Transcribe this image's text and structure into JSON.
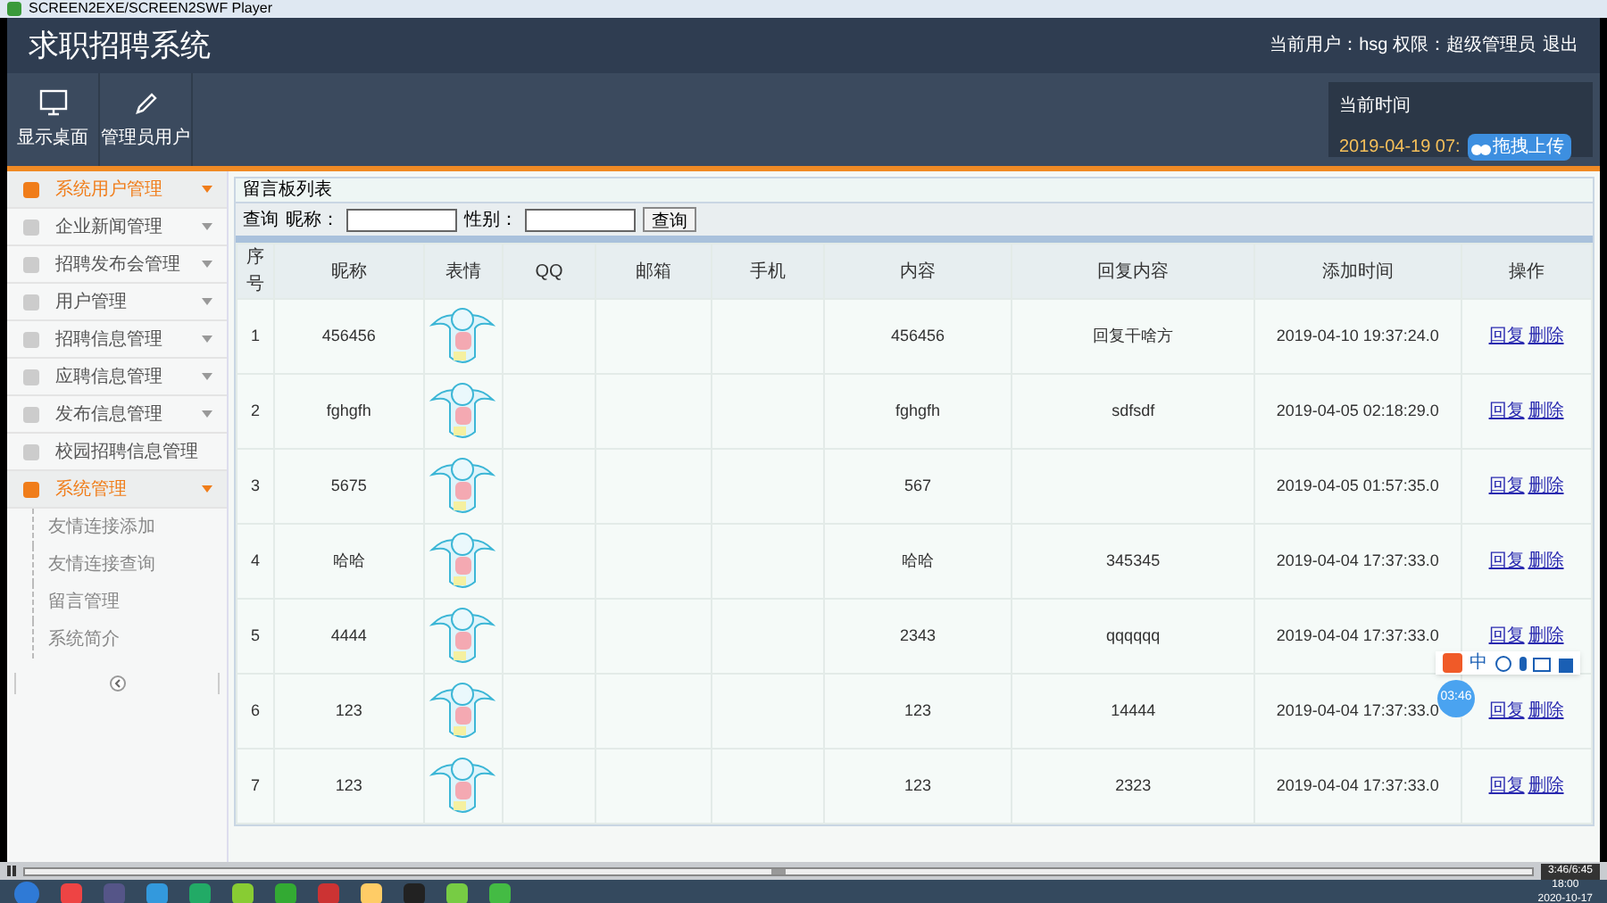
{
  "window": {
    "title": "SCREEN2EXE/SCREEN2SWF Player"
  },
  "header": {
    "title": "求职招聘系统",
    "user_info": "当前用户：hsg  权限：超级管理员",
    "logout": "退出"
  },
  "nav": [
    {
      "label": "显示桌面",
      "kind": "monitor"
    },
    {
      "label": "管理员用户",
      "kind": "pencil"
    }
  ],
  "time_panel": {
    "label": "当前时间",
    "value": "2019-04-19 07:",
    "upload_button": "拖拽上传"
  },
  "sidebar": {
    "items": [
      {
        "label": "系统用户管理",
        "selected": true
      },
      {
        "label": "企业新闻管理",
        "selected": false
      },
      {
        "label": "招聘发布会管理",
        "selected": false
      },
      {
        "label": "用户管理",
        "selected": false
      },
      {
        "label": "招聘信息管理",
        "selected": false
      },
      {
        "label": "应聘信息管理",
        "selected": false
      },
      {
        "label": "发布信息管理",
        "selected": false
      },
      {
        "label": "校园招聘信息管理",
        "selected": false
      },
      {
        "label": "系统管理",
        "selected": true,
        "children": [
          {
            "label": "友情连接添加"
          },
          {
            "label": "友情连接查询"
          },
          {
            "label": "留言管理"
          },
          {
            "label": "系统简介"
          }
        ]
      }
    ]
  },
  "panel": {
    "title": "留言板列表",
    "search": {
      "label": "查询",
      "fields": [
        {
          "label": "昵称："
        },
        {
          "label": "性别："
        }
      ],
      "button": "查询"
    }
  },
  "table": {
    "columns": [
      "序号",
      "昵称",
      "表情",
      "QQ",
      "邮箱",
      "手机",
      "内容",
      "回复内容",
      "添加时间",
      "操作"
    ],
    "rows": [
      {
        "no": "1",
        "nickname": "456456",
        "content": "456456",
        "reply": "回复干啥方",
        "time": "2019-04-10 19:37:24.0",
        "actions": [
          "回复",
          "删除"
        ]
      },
      {
        "no": "2",
        "nickname": "fghgfh",
        "content": "fghgfh",
        "reply": "sdfsdf",
        "time": "2019-04-05 02:18:29.0",
        "actions": [
          "回复",
          "删除"
        ]
      },
      {
        "no": "3",
        "nickname": "5675",
        "content": "567",
        "reply": "",
        "time": "2019-04-05 01:57:35.0",
        "actions": [
          "回复",
          "删除"
        ]
      },
      {
        "no": "4",
        "nickname": "哈哈",
        "content": "哈哈",
        "reply": "345345",
        "time": "2019-04-04 17:37:33.0",
        "actions": [
          "回复",
          "删除"
        ]
      },
      {
        "no": "5",
        "nickname": "4444",
        "content": "2343",
        "reply": "qqqqqq",
        "time": "2019-04-04 17:37:33.0",
        "actions": [
          "回复",
          "删除"
        ]
      },
      {
        "no": "6",
        "nickname": "123",
        "content": "123",
        "reply": "14444",
        "time": "2019-04-04 17:37:33.0",
        "actions": [
          "回复",
          "删除"
        ]
      },
      {
        "no": "7",
        "nickname": "123",
        "content": "123",
        "reply": "2323",
        "time": "2019-04-04 17:37:33.0",
        "actions": [
          "回复",
          "删除"
        ]
      }
    ]
  },
  "ime": {
    "label": "中",
    "timer": "03:46"
  },
  "player": {
    "time": "3:46/6:45"
  },
  "taskbar": {
    "time": "18:00",
    "date": "2020-10-17"
  }
}
